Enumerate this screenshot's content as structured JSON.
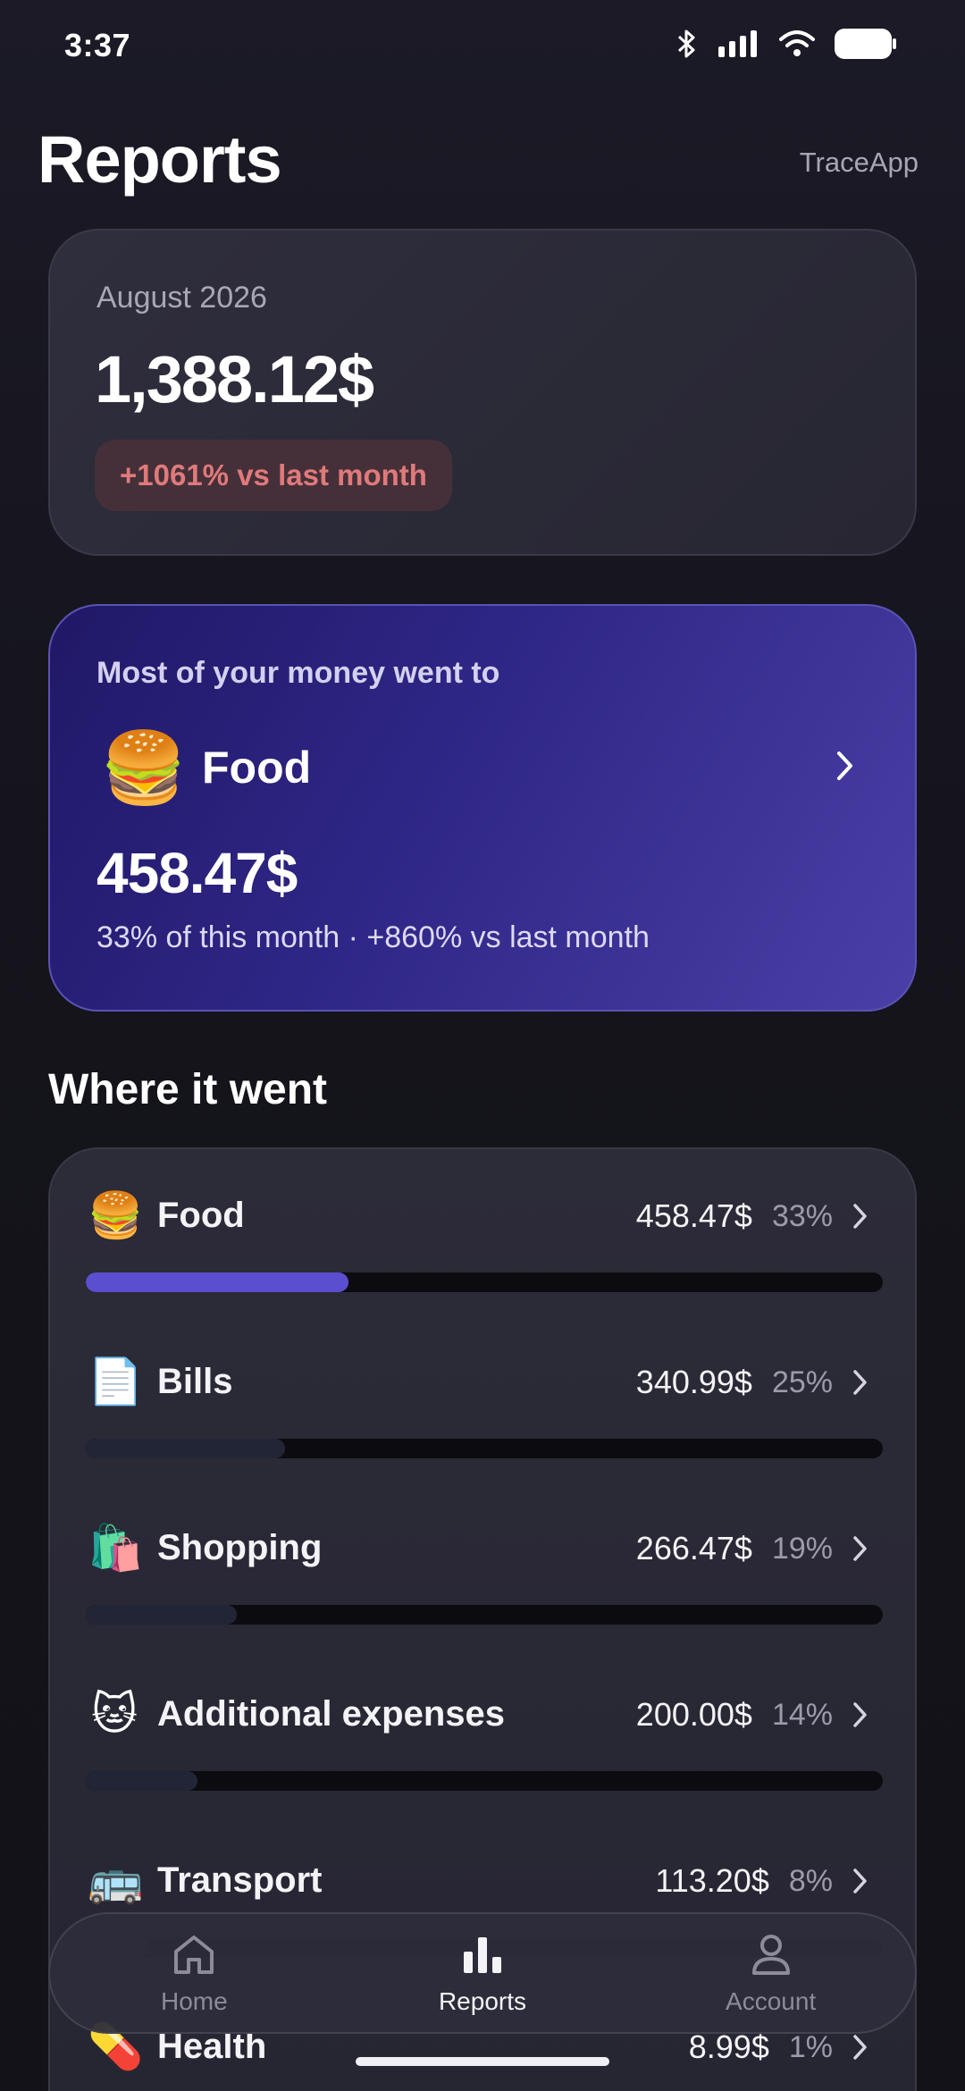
{
  "status_bar": {
    "time": "3:37"
  },
  "header": {
    "title": "Reports",
    "brand": "TraceApp"
  },
  "summary": {
    "month": "August 2026",
    "total": "1,388.12$",
    "badge": "+1061% vs last month"
  },
  "top_category": {
    "kicker": "Most of your money went to",
    "emoji": "🍔",
    "name": "Food",
    "amount": "458.47$",
    "subtitle": "33% of this month · +860% vs last month"
  },
  "section_title": "Where it went",
  "categories": [
    {
      "emoji": "🍔",
      "name": "Food",
      "amount": "458.47$",
      "percent": "33%",
      "share": 0.33,
      "color": "#5b4fd0"
    },
    {
      "emoji": "📄",
      "name": "Bills",
      "amount": "340.99$",
      "percent": "25%",
      "share": 0.25,
      "color": "#222535"
    },
    {
      "emoji": "🛍️",
      "name": "Shopping",
      "amount": "266.47$",
      "percent": "19%",
      "share": 0.19,
      "color": "#222535"
    },
    {
      "emoji": "🐱",
      "name": "Additional expenses",
      "amount": "200.00$",
      "percent": "14%",
      "share": 0.14,
      "color": "#222535"
    },
    {
      "emoji": "🚌",
      "name": "Transport",
      "amount": "113.20$",
      "percent": "8%",
      "share": 0.08,
      "color": "#222535"
    },
    {
      "emoji": "💊",
      "name": "Health",
      "amount": "8.99$",
      "percent": "1%",
      "share": 0.01,
      "color": "#222535"
    }
  ],
  "tabs": [
    {
      "label": "Home",
      "icon": "home-icon"
    },
    {
      "label": "Reports",
      "icon": "bar-chart-icon"
    },
    {
      "label": "Account",
      "icon": "person-icon"
    }
  ],
  "colors": {
    "accent": "#5b4fd0",
    "badge_text": "#e07a7a",
    "badge_bg": "#45303a"
  }
}
